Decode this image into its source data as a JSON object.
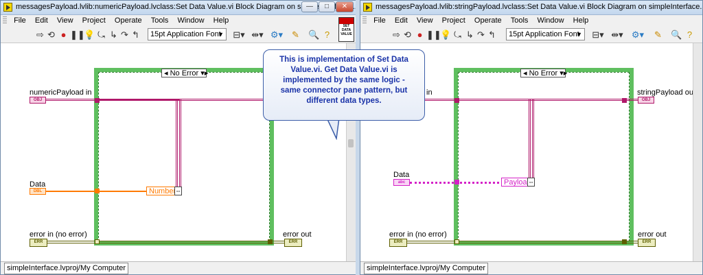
{
  "callout": {
    "text": "This is implementation of Set Data\nValue.vi. Get Data Value.vi is\nimplemented by the same logic -\nsame connector pane pattern, but\ndifferent  data types."
  },
  "left_window": {
    "title": "messagesPayload.lvlib:numericPayload.lvclass:Set Data Value.vi Block Diagram on simpleInterface....",
    "menu": [
      "File",
      "Edit",
      "View",
      "Project",
      "Operate",
      "Tools",
      "Window",
      "Help"
    ],
    "font_selector": "15pt Application Font",
    "vi_icon_text": "SET DATA VALUE",
    "case_selector": "No Error",
    "labels": {
      "input": "numericPayload in",
      "data": "Data",
      "error_in": "error in (no error)",
      "error_out": "error out"
    },
    "terminals": {
      "obj": "OBJ",
      "data": "DBL",
      "error": "ERR"
    },
    "bundler_label": "Number",
    "bundler_node": "⇔",
    "status": "simpleInterface.lvproj/My Computer"
  },
  "right_window": {
    "title": "messagesPayload.lvlib:stringPayload.lvclass:Set Data Value.vi Block Diagram on simpleInterface.lvproj/M...",
    "menu": [
      "File",
      "Edit",
      "View",
      "Project",
      "Operate",
      "Tools",
      "Window",
      "Help"
    ],
    "font_selector": "15pt Application Font",
    "case_selector": "No Error",
    "labels": {
      "input": "in",
      "output": "stringPayload out",
      "data": "Data",
      "error_in": "error in (no error)",
      "error_out": "error out"
    },
    "terminals": {
      "obj": "OBJ",
      "data": "abc",
      "error": "ERR"
    },
    "bundler_label": "Payload",
    "bundler_node": "⇔",
    "status": "simpleInterface.lvproj/My Computer"
  },
  "window_buttons": {
    "minimize": "—",
    "maximize": "□",
    "close": "✕"
  },
  "colors": {
    "class_wire": "#b0186a",
    "double_wire": "#ff7a00",
    "string_wire": "#d421c7",
    "error_wire": "#5d5e00",
    "case_border": "#5fbf5f",
    "callout_text": "#1a33a8"
  }
}
